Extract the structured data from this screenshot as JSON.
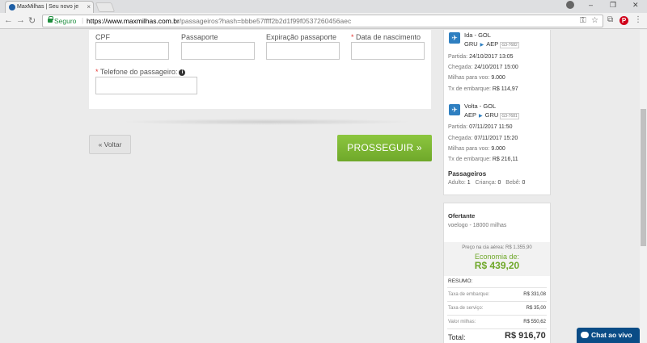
{
  "browser": {
    "tab_title": "MaxMilhas | Seu novo je",
    "secure_label": "Seguro",
    "url_host": "https://www.maxmilhas.com.br",
    "url_path": "/passageiros?hash=bbbe57ffff2b2d1f99f0537260456aec"
  },
  "form": {
    "cpf_label": "CPF",
    "passport_label": "Passaporte",
    "passport_exp_label": "Expiração passaporte",
    "birthdate_label": "Data de nascimento",
    "phone_label": "Telefone do passageiro:",
    "cpf_value": "",
    "passport_value": "",
    "passport_exp_value": "",
    "birthdate_value": "",
    "phone_value": ""
  },
  "actions": {
    "back_label": "« Voltar",
    "next_label": "PROSSEGUIR »"
  },
  "outbound": {
    "title": "Ida - GOL",
    "from": "GRU",
    "to": "AEP",
    "code": "G3-7682",
    "departure_label": "Partida:",
    "departure": "24/10/2017 13:05",
    "arrival_label": "Chegada:",
    "arrival": "24/10/2017 15:00",
    "miles_label": "Milhas para voo:",
    "miles": "9.000",
    "tax_label": "Tx de embarque:",
    "tax": "R$ 114,97"
  },
  "return": {
    "title": "Volta - GOL",
    "from": "AEP",
    "to": "GRU",
    "code": "G3-7681",
    "departure_label": "Partida:",
    "departure": "07/11/2017 11:50",
    "arrival_label": "Chegada:",
    "arrival": "07/11/2017 15:20",
    "miles_label": "Milhas para voo:",
    "miles": "9.000",
    "tax_label": "Tx de embarque:",
    "tax": "R$ 216,11"
  },
  "passengers": {
    "title": "Passageiros",
    "adult_label": "Adulto:",
    "adult": "1",
    "child_label": "Criança:",
    "child": "0",
    "baby_label": "Bebê:",
    "baby": "0"
  },
  "offer": {
    "title": "Ofertante",
    "seller": "voelogo - 18000 milhas",
    "airline_price": "Preço na cia aérea: R$ 1.355,90",
    "savings_label": "Economia de:",
    "savings_value": "R$ 439,20",
    "summary_label": "RESUMO:",
    "rows": [
      {
        "label": "Taxa de embarque:",
        "value": "R$ 331,08"
      },
      {
        "label": "Taxa de serviço:",
        "value": "R$ 35,00"
      },
      {
        "label": "Valor milhas:",
        "value": "R$ 550,62"
      }
    ],
    "total_label": "Total:",
    "total_value": "R$ 916,70"
  },
  "chat": {
    "label": "Chat ao vivo"
  },
  "colors": {
    "accent_green": "#8cc63f",
    "link_blue": "#2e7fc1",
    "chat_blue": "#0a4c86"
  }
}
